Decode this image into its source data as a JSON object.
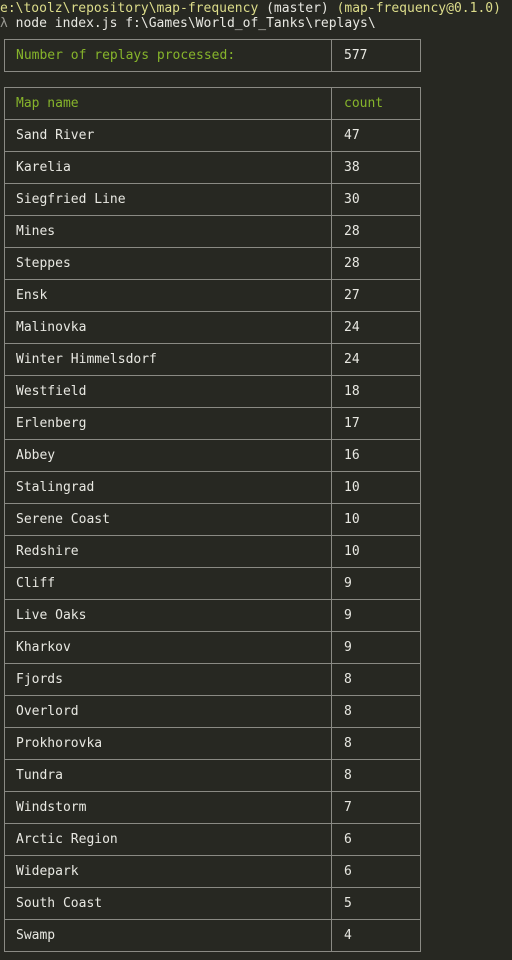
{
  "terminal": {
    "path": "e:\\toolz\\repository\\map-frequency",
    "branch": "(master)",
    "package": "(map-frequency@0.1.0)",
    "prompt_symbol": "λ",
    "command": "node index.js f:\\Games\\World_of_Tanks\\replays\\"
  },
  "summary": {
    "label": "Number of replays processed:",
    "value": "577"
  },
  "map_table": {
    "headers": [
      "Map name",
      "count"
    ],
    "rows": [
      [
        "Sand River",
        "47"
      ],
      [
        "Karelia",
        "38"
      ],
      [
        "Siegfried Line",
        "30"
      ],
      [
        "Mines",
        "28"
      ],
      [
        "Steppes",
        "28"
      ],
      [
        "Ensk",
        "27"
      ],
      [
        "Malinovka",
        "24"
      ],
      [
        "Winter Himmelsdorf",
        "24"
      ],
      [
        "Westfield",
        "18"
      ],
      [
        "Erlenberg",
        "17"
      ],
      [
        "Abbey",
        "16"
      ],
      [
        "Stalingrad",
        "10"
      ],
      [
        "Serene Coast",
        "10"
      ],
      [
        "Redshire",
        "10"
      ],
      [
        "Cliff",
        "9"
      ],
      [
        "Live Oaks",
        "9"
      ],
      [
        "Kharkov",
        "9"
      ],
      [
        "Fjords",
        "8"
      ],
      [
        "Overlord",
        "8"
      ],
      [
        "Prokhorovka",
        "8"
      ],
      [
        "Tundra",
        "8"
      ],
      [
        "Windstorm",
        "7"
      ],
      [
        "Arctic Region",
        "6"
      ],
      [
        "Widepark",
        "6"
      ],
      [
        "South Coast",
        "5"
      ],
      [
        "Swamp",
        "4"
      ]
    ]
  },
  "colors": {
    "background": "#272822",
    "text": "#e8e8e2",
    "header_green": "#86b42b",
    "prompt_yellow": "#dcdc8a",
    "border": "#8a8a84"
  }
}
